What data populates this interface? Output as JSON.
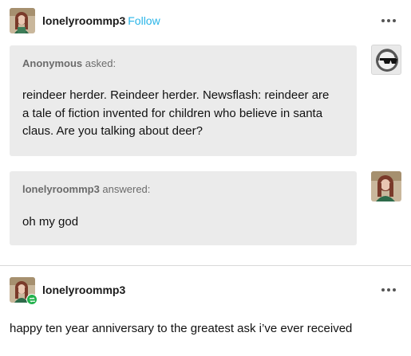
{
  "post": {
    "username": "lonelyroommp3",
    "follow_label": "Follow"
  },
  "ask": {
    "asker": "Anonymous",
    "asked_label": "asked:",
    "question_lines": [
      "reindeer herder. Reindeer herder. Newsflash: reindeer are",
      "a tale of fiction invented for children who believe in santa",
      "claus. Are you talking about deer?"
    ]
  },
  "answer": {
    "answerer": "lonelyroommp3",
    "answered_label": "answered:",
    "text": "oh my god"
  },
  "reblog": {
    "username": "lonelyroommp3",
    "body": "happy ten year anniversary to the greatest ask i’ve ever received"
  },
  "icons": {
    "more": "more-horizontal-icon",
    "reblog": "reblog-icon",
    "anon_avatar": "anonymous-sunglasses-avatar"
  },
  "colors": {
    "follow": "#29b5e8",
    "bubble": "#ebebeb",
    "reblog_badge": "#22b14c"
  }
}
